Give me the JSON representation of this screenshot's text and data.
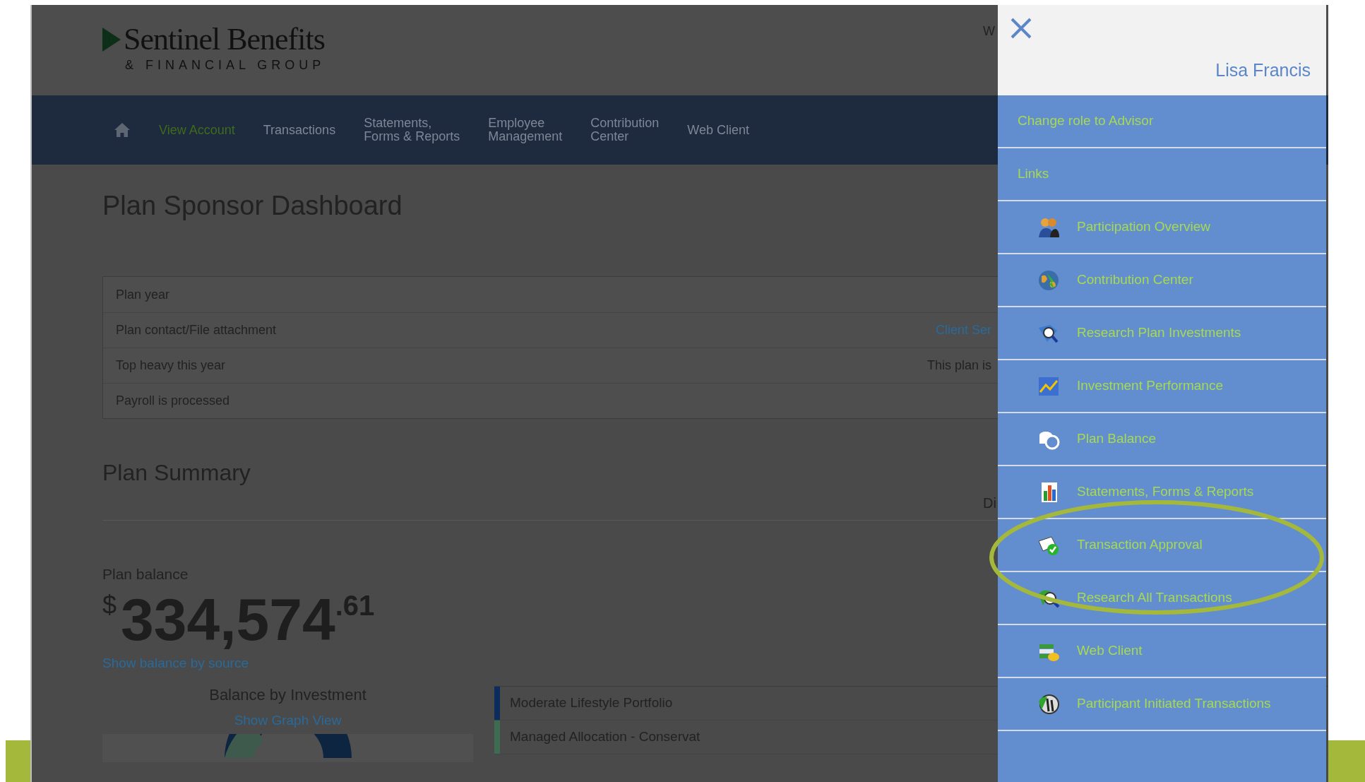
{
  "header": {
    "logo_name": "Sentinel Benefits",
    "logo_sub": "& FINANCIAL GROUP",
    "corner_text": "W"
  },
  "nav": [
    {
      "label": "View Account",
      "selected": true
    },
    {
      "label": "Transactions",
      "selected": false
    },
    {
      "label": "Statements,\nForms & Reports",
      "selected": false
    },
    {
      "label": "Employee\nManagement",
      "selected": false
    },
    {
      "label": "Contribution\nCenter",
      "selected": false
    },
    {
      "label": "Web Client",
      "selected": false
    }
  ],
  "page_title": "Plan Sponsor Dashboard",
  "details": [
    {
      "label": "Plan year"
    },
    {
      "label": "Plan contact/File attachment",
      "value": "Client Ser",
      "kind": "link"
    },
    {
      "label": "Top heavy this year",
      "value": "This plan is",
      "kind": "text"
    },
    {
      "label": "Payroll is processed"
    }
  ],
  "summary": {
    "title": "Plan Summary",
    "side_text": "Di",
    "balance_label": "Plan balance",
    "currency": "$",
    "balance_whole": "334,574",
    "balance_cents": ".61",
    "balance_link": "Show balance by source",
    "investment_title": "Balance by Investment",
    "graph_link": "Show Graph View",
    "funds": [
      {
        "name": "Moderate Lifestyle Portfolio",
        "color": "#0b2d5e"
      },
      {
        "name": "Managed Allocation - Conservat",
        "color": "#3e6b52"
      }
    ]
  },
  "panel": {
    "user_name": "Lisa Francis",
    "items": [
      {
        "kind": "action",
        "label": "Change role to Advisor"
      },
      {
        "kind": "heading",
        "label": "Links"
      },
      {
        "kind": "link",
        "label": "Participation Overview"
      },
      {
        "kind": "link",
        "label": "Contribution Center"
      },
      {
        "kind": "link",
        "label": "Research Plan Investments"
      },
      {
        "kind": "link",
        "label": "Investment Performance"
      },
      {
        "kind": "link",
        "label": "Plan Balance"
      },
      {
        "kind": "link",
        "label": "Statements, Forms & Reports"
      },
      {
        "kind": "link",
        "label": "Transaction Approval",
        "highlighted": true
      },
      {
        "kind": "link",
        "label": "Research All Transactions"
      },
      {
        "kind": "link",
        "label": "Web Client"
      },
      {
        "kind": "link",
        "label": "Participant Initiated Transactions"
      }
    ]
  }
}
